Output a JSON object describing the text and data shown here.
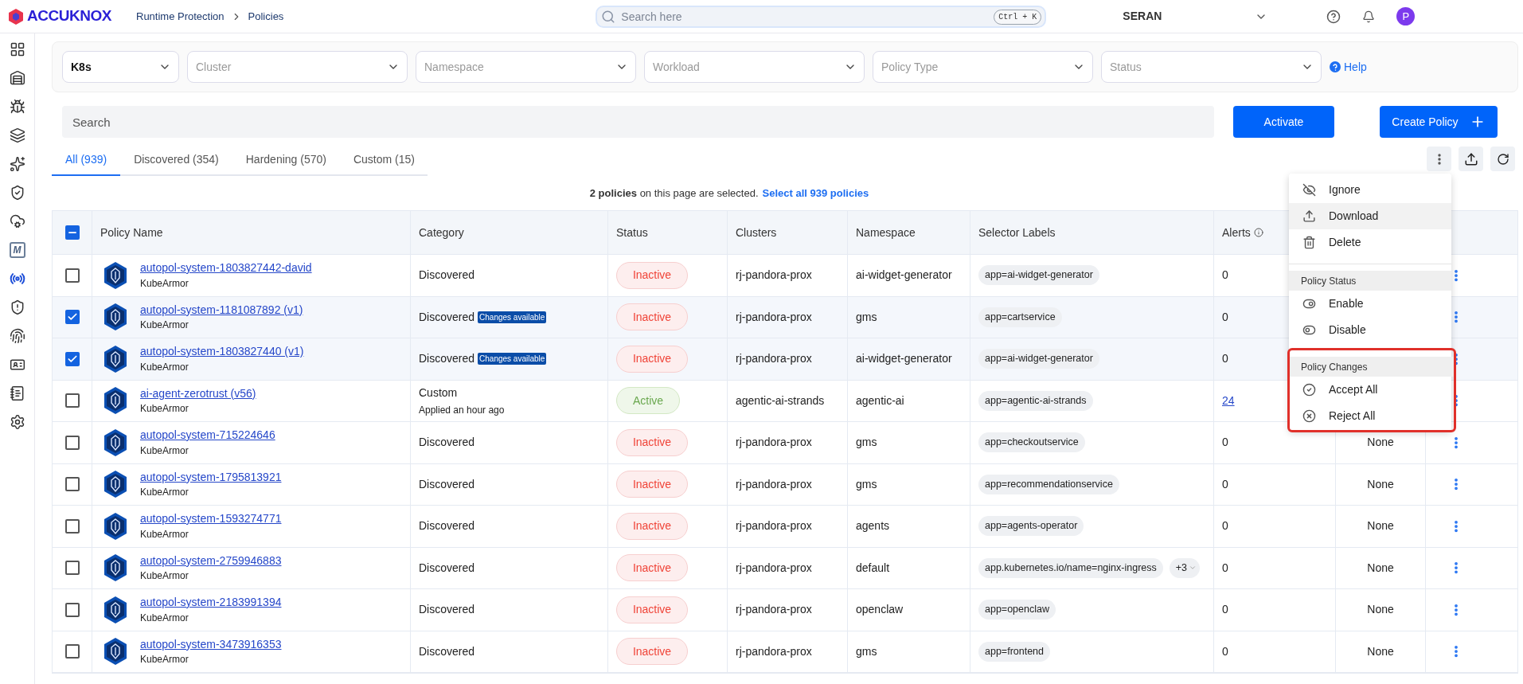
{
  "header": {
    "logo_text": "ACCUKNOX",
    "breadcrumbs": [
      {
        "label": "Runtime Protection"
      },
      {
        "label": "Policies"
      }
    ],
    "search": {
      "placeholder": "Search here",
      "shortcut": "Ctrl + K"
    },
    "workspace": "SERAN",
    "avatar": "P"
  },
  "sidebar": {
    "items": [
      {
        "selected": false
      },
      {
        "selected": false
      },
      {
        "selected": false
      },
      {
        "selected": false
      },
      {
        "selected": false
      },
      {
        "selected": false
      },
      {
        "selected": false
      },
      {
        "selected": false,
        "label": "M"
      },
      {
        "selected": true
      },
      {
        "selected": false
      },
      {
        "selected": false
      },
      {
        "selected": false
      },
      {
        "selected": false
      },
      {
        "selected": false
      }
    ]
  },
  "filters": [
    {
      "value": "K8s"
    },
    {
      "placeholder": "Cluster"
    },
    {
      "placeholder": "Namespace"
    },
    {
      "placeholder": "Workload"
    },
    {
      "placeholder": "Policy Type"
    },
    {
      "placeholder": "Status"
    }
  ],
  "help_link": "Help",
  "search": {
    "placeholder": "Search"
  },
  "buttons": {
    "activate": "Activate",
    "create": "Create Policy"
  },
  "tabs": [
    {
      "label": "All (939)",
      "selected": true
    },
    {
      "label": "Discovered (354)",
      "selected": false
    },
    {
      "label": "Hardening (570)",
      "selected": false
    },
    {
      "label": "Custom (15)",
      "selected": false
    }
  ],
  "selection_notice": {
    "text": "**2 policies** on this page are selected.",
    "link": "Select all 939 policies"
  },
  "table": {
    "select_all": {
      "indeterminate": true
    },
    "columns": [
      "Policy Name",
      "Category",
      "Status",
      "Clusters",
      "Namespace",
      "Selector Labels",
      "Alerts"
    ],
    "rows": [
      {
        "checked": false,
        "name": "autopol-system-1803827442-david",
        "engine": "KubeArmor",
        "category": "Discovered",
        "status": {
          "label": "Inactive",
          "kind": "inactive"
        },
        "cluster": "rj-pandora-prox",
        "namespace": "ai-widget-generator",
        "labels": [
          "app=ai-widget-generator"
        ],
        "alerts": "0",
        "alerts_link": false
      },
      {
        "checked": true,
        "name": "autopol-system-1181087892 (v1)",
        "engine": "KubeArmor",
        "category": "Discovered",
        "badge": "Changes available",
        "status": {
          "label": "Inactive",
          "kind": "inactive"
        },
        "cluster": "rj-pandora-prox",
        "namespace": "gms",
        "labels": [
          "app=cartservice"
        ],
        "alerts": "0",
        "alerts_link": false
      },
      {
        "checked": true,
        "name": "autopol-system-1803827440 (v1)",
        "engine": "KubeArmor",
        "category": "Discovered",
        "badge": "Changes available",
        "status": {
          "label": "Inactive",
          "kind": "inactive"
        },
        "cluster": "rj-pandora-prox",
        "namespace": "ai-widget-generator",
        "labels": [
          "app=ai-widget-generator"
        ],
        "alerts": "0",
        "alerts_link": false
      },
      {
        "checked": false,
        "name": "ai-agent-zerotrust (v56)",
        "engine": "KubeArmor",
        "category": "Custom",
        "note": "Applied an hour ago",
        "status": {
          "label": "Active",
          "kind": "active"
        },
        "cluster": "agentic-ai-strands",
        "namespace": "agentic-ai",
        "labels": [
          "app=agentic-ai-strands"
        ],
        "alerts": "24",
        "alerts_link": true
      },
      {
        "checked": false,
        "name": "autopol-system-715224646",
        "engine": "KubeArmor",
        "category": "Discovered",
        "status": {
          "label": "Inactive",
          "kind": "inactive"
        },
        "cluster": "rj-pandora-prox",
        "namespace": "gms",
        "labels": [
          "app=checkoutservice"
        ],
        "alerts": "0",
        "alerts_link": false,
        "column_8": "None"
      },
      {
        "checked": false,
        "name": "autopol-system-1795813921",
        "engine": "KubeArmor",
        "category": "Discovered",
        "status": {
          "label": "Inactive",
          "kind": "inactive"
        },
        "cluster": "rj-pandora-prox",
        "namespace": "gms",
        "labels": [
          "app=recommendationservice"
        ],
        "alerts": "0",
        "alerts_link": false,
        "column_8": "None"
      },
      {
        "checked": false,
        "name": "autopol-system-1593274771",
        "engine": "KubeArmor",
        "category": "Discovered",
        "status": {
          "label": "Inactive",
          "kind": "inactive"
        },
        "cluster": "rj-pandora-prox",
        "namespace": "agents",
        "labels": [
          "app=agents-operator"
        ],
        "alerts": "0",
        "alerts_link": false,
        "column_8": "None"
      },
      {
        "checked": false,
        "name": "autopol-system-2759946883",
        "engine": "KubeArmor",
        "category": "Discovered",
        "status": {
          "label": "Inactive",
          "kind": "inactive"
        },
        "cluster": "rj-pandora-prox",
        "namespace": "default",
        "labels": [
          "app.kubernetes.io/name=nginx-ingress"
        ],
        "more": "+3",
        "alerts": "0",
        "alerts_link": false,
        "column_8": "None"
      },
      {
        "checked": false,
        "name": "autopol-system-2183991394",
        "engine": "KubeArmor",
        "category": "Discovered",
        "status": {
          "label": "Inactive",
          "kind": "inactive"
        },
        "cluster": "rj-pandora-prox",
        "namespace": "openclaw",
        "labels": [
          "app=openclaw"
        ],
        "alerts": "0",
        "alerts_link": false,
        "column_8": "None"
      },
      {
        "checked": false,
        "name": "autopol-system-3473916353",
        "engine": "KubeArmor",
        "category": "Discovered",
        "status": {
          "label": "Inactive",
          "kind": "inactive"
        },
        "cluster": "rj-pandora-prox",
        "namespace": "gms",
        "labels": [
          "app=frontend"
        ],
        "alerts": "0",
        "alerts_link": false,
        "column_8": "None"
      }
    ]
  },
  "action_menu": {
    "sections": [
      {
        "highlighted": false,
        "items": [
          {
            "label": "Ignore",
            "kind": "ignore",
            "selected": false
          },
          {
            "label": "Download",
            "kind": "download",
            "selected": true
          },
          {
            "label": "Delete",
            "kind": "delete",
            "selected": false
          }
        ]
      },
      {
        "header": "Policy Status",
        "highlighted": false,
        "items": [
          {
            "label": "Enable",
            "kind": "enable",
            "selected": false
          },
          {
            "label": "Disable",
            "kind": "disable",
            "selected": false
          }
        ]
      },
      {
        "header": "Policy Changes",
        "highlighted": true,
        "items": [
          {
            "label": "Accept All",
            "kind": "accept",
            "selected": false
          },
          {
            "label": "Reject All",
            "kind": "reject",
            "selected": false
          }
        ]
      }
    ]
  }
}
